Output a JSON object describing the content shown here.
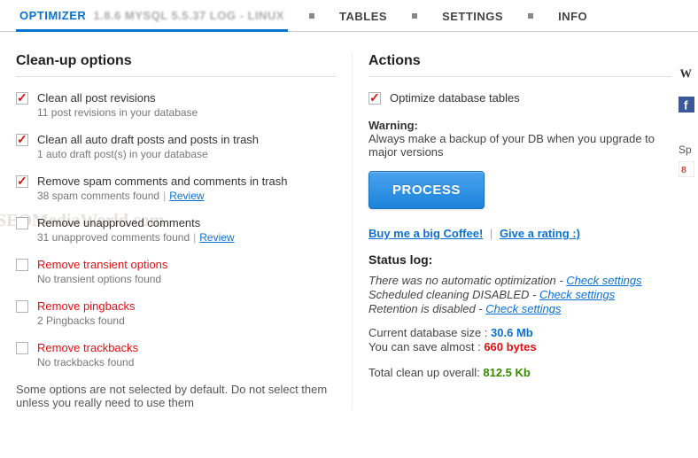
{
  "tabs": {
    "optimizer": "OPTIMIZER",
    "optimizer_extra": "1.8.6  MYSQL 5.5.37 LOG - LINUX",
    "tables": "TABLES",
    "settings": "SETTINGS",
    "info": "INFO"
  },
  "cleanup": {
    "title": "Clean-up options",
    "items": [
      {
        "label": "Clean all post revisions",
        "sub": "11 post revisions in your database",
        "checked": true,
        "red": false,
        "review": false
      },
      {
        "label": "Clean all auto draft posts and posts in trash",
        "sub": "1 auto draft post(s) in your database",
        "checked": true,
        "red": false,
        "review": false
      },
      {
        "label": "Remove spam comments and comments in trash",
        "sub": "38 spam comments found",
        "checked": true,
        "red": false,
        "review": true
      },
      {
        "label": "Remove unapproved comments",
        "sub": "31 unapproved comments found",
        "checked": false,
        "red": false,
        "review": true
      },
      {
        "label": "Remove transient options",
        "sub": "No transient options found",
        "checked": false,
        "red": true,
        "review": false
      },
      {
        "label": "Remove pingbacks",
        "sub": "2 Pingbacks found",
        "checked": false,
        "red": true,
        "review": false
      },
      {
        "label": "Remove trackbacks",
        "sub": "No trackbacks found",
        "checked": false,
        "red": true,
        "review": false
      }
    ],
    "review": "Review",
    "note": "Some options are not selected by default. Do not select them unless you really need to use them"
  },
  "actions": {
    "title": "Actions",
    "optimize": {
      "label": "Optimize database tables",
      "checked": true
    },
    "warning_label": "Warning:",
    "warning_text": "Always make a backup of your DB when you upgrade to major versions",
    "process": "PROCESS",
    "link_coffee": "Buy me a big Coffee!",
    "link_rating": "Give a rating :)"
  },
  "status": {
    "title": "Status log:",
    "lines": [
      {
        "text": "There was no automatic optimization - ",
        "link": "Check settings"
      },
      {
        "text": "Scheduled cleaning DISABLED - ",
        "link": "Check settings"
      },
      {
        "text": "Retention is disabled - ",
        "link": "Check settings"
      }
    ],
    "db_size_label": "Current database size : ",
    "db_size_value": "30.6 Mb",
    "save_label": "You can save almost : ",
    "save_value": "660 bytes",
    "total_label": "Total clean up overall: ",
    "total_value": "812.5 Kb"
  },
  "watermark": "SEOMediaWorld.com",
  "sidebar": {
    "label": "Sp"
  }
}
